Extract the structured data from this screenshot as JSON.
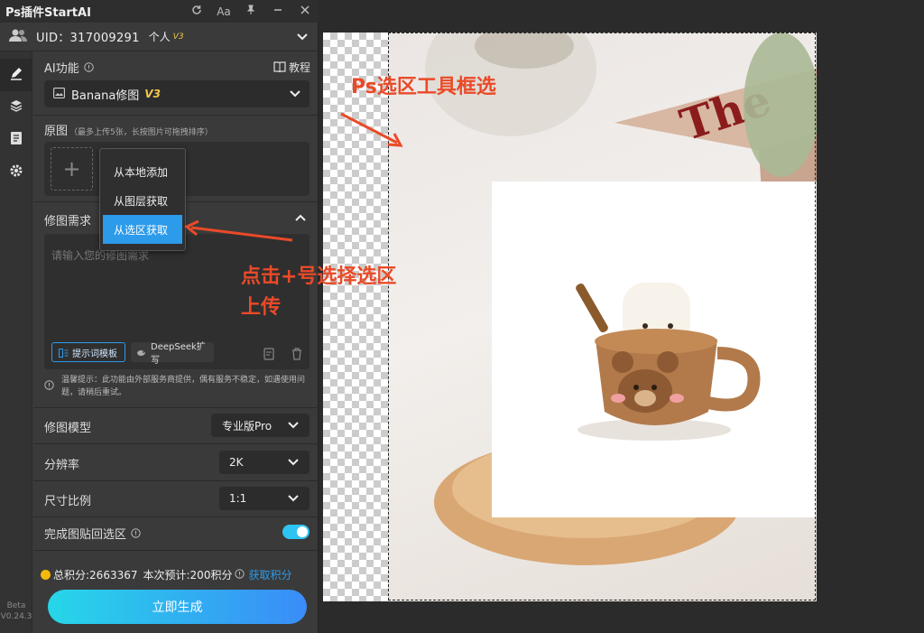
{
  "titlebar": {
    "title": "Ps插件StartAI",
    "refresh_icon": "refresh-icon",
    "font_label": "Aa",
    "pin_icon": "pin-icon"
  },
  "user": {
    "uid": "UID：317009291",
    "plan": "个人",
    "plan_badge": "V3"
  },
  "ai": {
    "label": "AI功能",
    "tutorial": "教程",
    "model_select": "Banana修图",
    "model_badge": "V3"
  },
  "source": {
    "label": "原图",
    "hint": "（最多上传5张，长按图片可拖拽排序）",
    "add_symbol": "+"
  },
  "menu": {
    "items": [
      "从本地添加",
      "从图层获取",
      "从选区获取"
    ],
    "selected": "从选区获取"
  },
  "edit": {
    "label": "修图需求",
    "placeholder": "请输入您的修图需求",
    "template_btn": "提示词模板",
    "deepseek_btn": "DeepSeek扩写"
  },
  "tip": {
    "text": "温馨提示：此功能由外部服务商提供，偶有服务不稳定，如遇使用问题，请稍后重试。"
  },
  "settings": {
    "model_label": "修图模型",
    "model_value": "专业版Pro",
    "resolution_label": "分辨率",
    "resolution_value": "2K",
    "ratio_label": "尺寸比例",
    "ratio_value": "1:1",
    "paste_back_label": "完成图贴回选区",
    "paste_back_on": true
  },
  "footer": {
    "points": "总积分:2663367",
    "estimate": "本次预计:200积分",
    "get_points": "获取积分",
    "generate": "立即生成",
    "beta": "Beta",
    "version": "V0.24.3"
  },
  "annotations": {
    "top": "Ps选区工具框选",
    "middle_line1": "点击+号选择选区",
    "middle_line2": "上传"
  },
  "colors": {
    "accent_cyan": "#2ec4f2",
    "accent_blue": "#2c9bea",
    "annotation_red": "#ea4a28",
    "badge_yellow": "#f2c94c"
  }
}
